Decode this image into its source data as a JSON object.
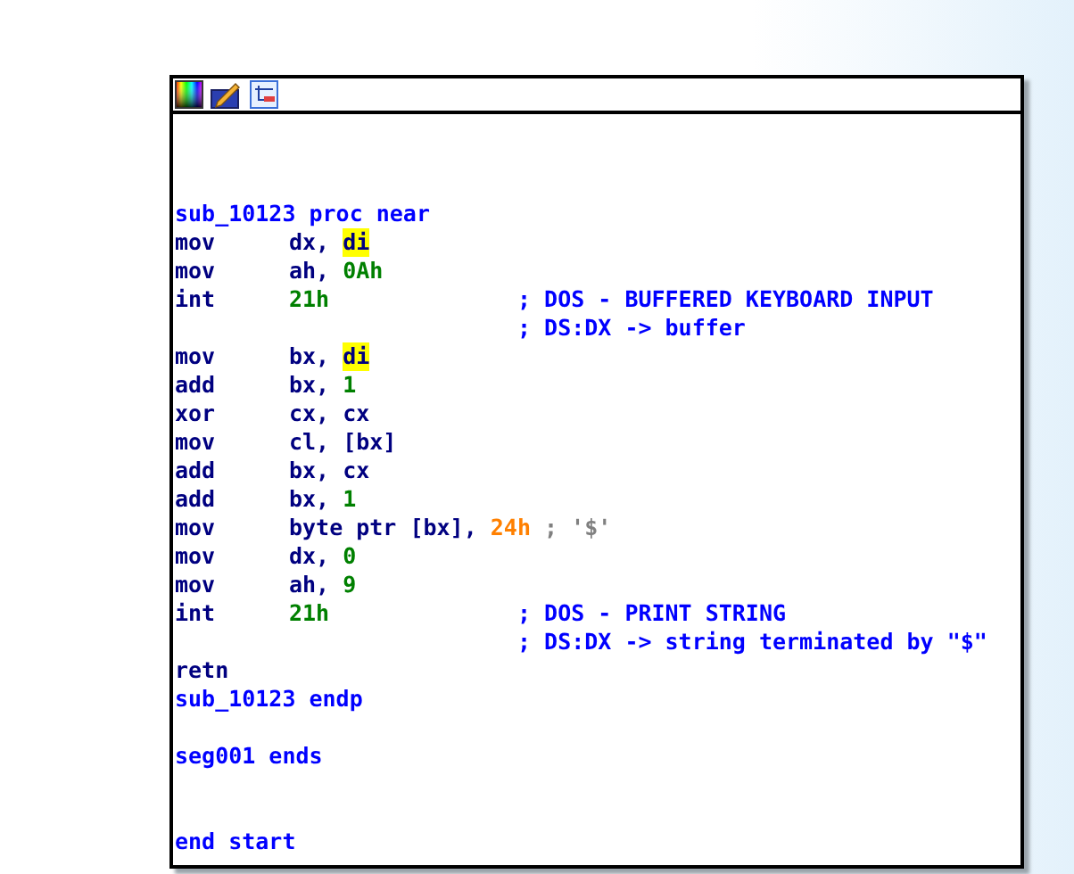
{
  "lines": [
    {
      "kind": "blank"
    },
    {
      "kind": "blank"
    },
    {
      "kind": "blank"
    },
    {
      "kind": "label",
      "text": "sub_10123 proc near"
    },
    {
      "kind": "code",
      "mnemonic": "mov",
      "operands": [
        {
          "text": "dx, ",
          "kind": "plain"
        },
        {
          "text": "di",
          "kind": "highlight"
        }
      ]
    },
    {
      "kind": "code",
      "mnemonic": "mov",
      "operands": [
        {
          "text": "ah, ",
          "kind": "plain"
        },
        {
          "text": "0Ah",
          "kind": "number"
        }
      ]
    },
    {
      "kind": "code",
      "mnemonic": "int",
      "operands": [
        {
          "text": "21h",
          "kind": "number"
        }
      ],
      "comment": "; DOS - BUFFERED KEYBOARD INPUT"
    },
    {
      "kind": "comment",
      "text": "; DS:DX -> buffer"
    },
    {
      "kind": "code",
      "mnemonic": "mov",
      "operands": [
        {
          "text": "bx, ",
          "kind": "plain"
        },
        {
          "text": "di",
          "kind": "highlight"
        }
      ]
    },
    {
      "kind": "code",
      "mnemonic": "add",
      "operands": [
        {
          "text": "bx, ",
          "kind": "plain"
        },
        {
          "text": "1",
          "kind": "number"
        }
      ]
    },
    {
      "kind": "code",
      "mnemonic": "xor",
      "operands": [
        {
          "text": "cx, cx",
          "kind": "plain"
        }
      ]
    },
    {
      "kind": "code",
      "mnemonic": "mov",
      "operands": [
        {
          "text": "cl, [bx]",
          "kind": "plain"
        }
      ]
    },
    {
      "kind": "code",
      "mnemonic": "add",
      "operands": [
        {
          "text": "bx, cx",
          "kind": "plain"
        }
      ]
    },
    {
      "kind": "code",
      "mnemonic": "add",
      "operands": [
        {
          "text": "bx, ",
          "kind": "plain"
        },
        {
          "text": "1",
          "kind": "number"
        }
      ]
    },
    {
      "kind": "code",
      "mnemonic": "mov",
      "operands": [
        {
          "text": "byte ptr [bx], ",
          "kind": "plain"
        },
        {
          "text": "24h",
          "kind": "constant"
        },
        {
          "text": " ; '$'",
          "kind": "auto_comment"
        }
      ]
    },
    {
      "kind": "code",
      "mnemonic": "mov",
      "operands": [
        {
          "text": "dx, ",
          "kind": "plain"
        },
        {
          "text": "0",
          "kind": "number"
        }
      ]
    },
    {
      "kind": "code",
      "mnemonic": "mov",
      "operands": [
        {
          "text": "ah, ",
          "kind": "plain"
        },
        {
          "text": "9",
          "kind": "number"
        }
      ]
    },
    {
      "kind": "code",
      "mnemonic": "int",
      "operands": [
        {
          "text": "21h",
          "kind": "number"
        }
      ],
      "comment": "; DOS - PRINT STRING"
    },
    {
      "kind": "comment",
      "text": "; DS:DX -> string terminated by \"$\""
    },
    {
      "kind": "code",
      "mnemonic": "retn"
    },
    {
      "kind": "label",
      "text": "sub_10123 endp"
    },
    {
      "kind": "blank"
    },
    {
      "kind": "label",
      "text": "seg001 ends"
    },
    {
      "kind": "blank"
    },
    {
      "kind": "blank"
    },
    {
      "kind": "label",
      "text": "end start"
    }
  ]
}
